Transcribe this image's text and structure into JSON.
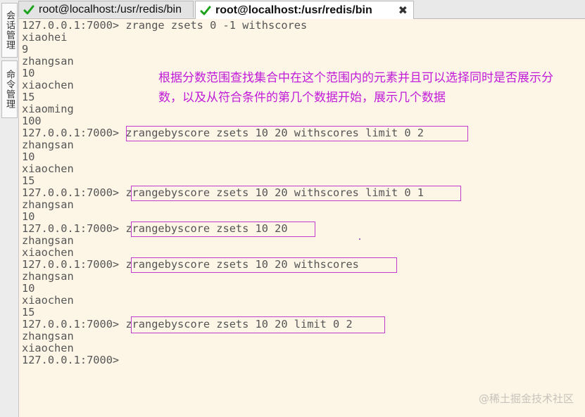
{
  "side_tabs": [
    "会话管理",
    "命令管理"
  ],
  "tabs": [
    {
      "label": "root@localhost:/usr/redis/bin",
      "active": false
    },
    {
      "label": "root@localhost:/usr/redis/bin",
      "active": true,
      "close": "✖"
    }
  ],
  "terminal": {
    "lines": [
      "127.0.0.1:7000> zrange zsets 0 -1 withscores",
      "xiaohei",
      "9",
      "zhangsan",
      "10",
      "xiaochen",
      "15",
      "xiaoming",
      "100",
      "127.0.0.1:7000> zrangebyscore zsets 10 20 withscores limit 0 2",
      "zhangsan",
      "10",
      "xiaochen",
      "15",
      "127.0.0.1:7000> zrangebyscore zsets 10 20 withscores limit 0 1",
      "zhangsan",
      "10",
      "127.0.0.1:7000> zrangebyscore zsets 10 20",
      "zhangsan",
      "xiaochen",
      "127.0.0.1:7000> zrangebyscore zsets 10 20 withscores",
      "zhangsan",
      "10",
      "xiaochen",
      "15",
      "127.0.0.1:7000> zrangebyscore zsets 10 20 limit 0 2",
      "zhangsan",
      "xiaochen",
      "127.0.0.1:7000>"
    ]
  },
  "annotation": "根据分数范围查找集合中在这个范围内的元素并且可以选择同时是否展示分数，以及从符合条件的第几个数据开始，展示几个数据",
  "watermark": "@稀土掘金技术社区",
  "colors": {
    "highlight": "#c23bcf",
    "annotation": "#c01ad8",
    "terminal_bg": "#fdf6e7",
    "check": "#1aa31a"
  },
  "icons": {
    "tab_status": "check-icon"
  }
}
